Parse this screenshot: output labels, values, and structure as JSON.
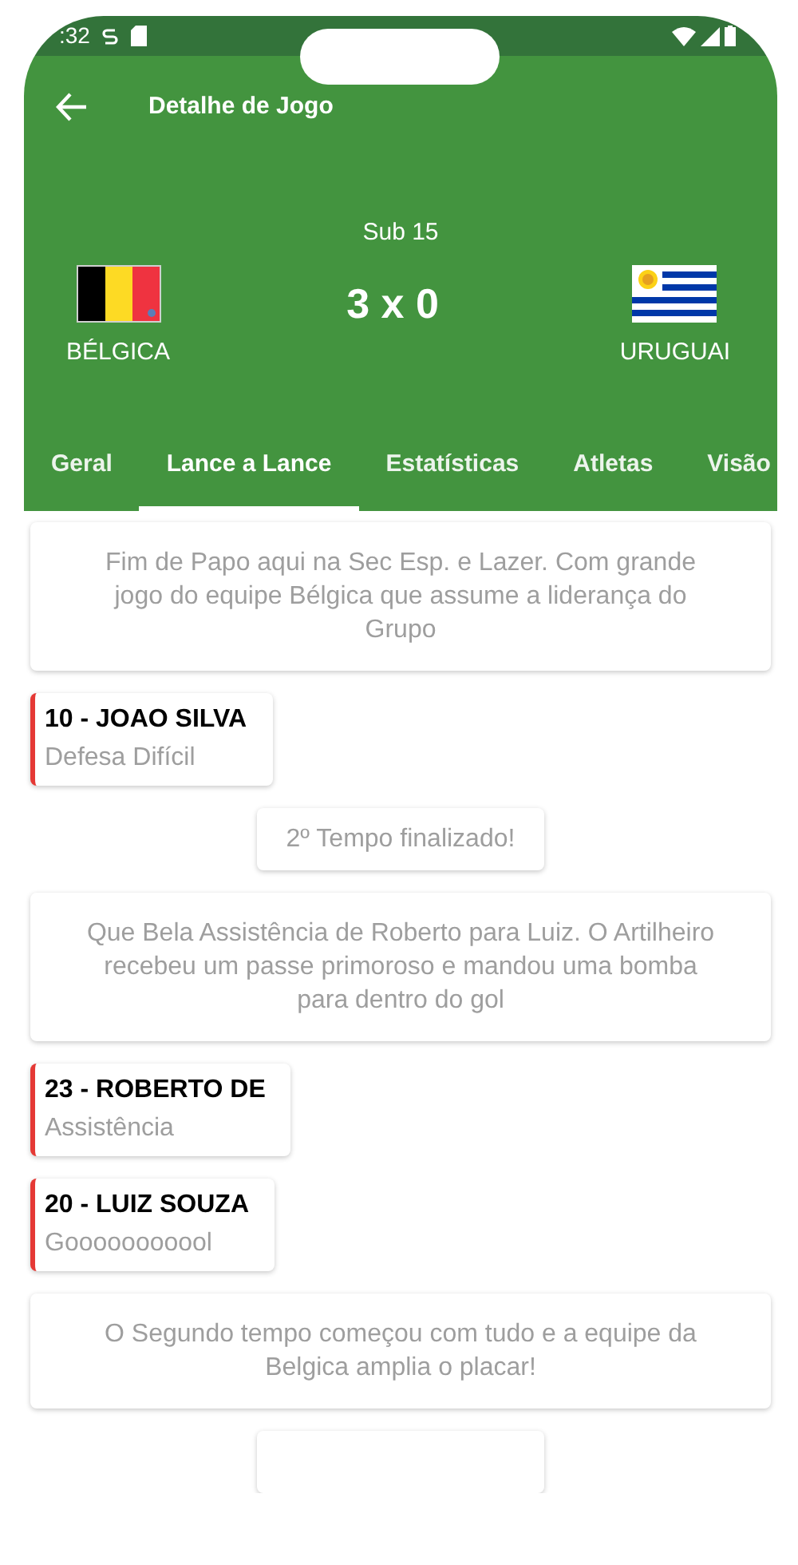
{
  "status_bar": {
    "time": ":32"
  },
  "toolbar": {
    "title": "Detalhe de Jogo"
  },
  "match": {
    "category": "Sub 15",
    "score": "3 x 0",
    "home": {
      "name": "BÉLGICA",
      "kind": "belgium"
    },
    "away": {
      "name": "URUGUAI",
      "kind": "uruguay"
    }
  },
  "tabs": [
    {
      "label": "Geral",
      "selected": false
    },
    {
      "label": "Lance a Lance",
      "selected": true
    },
    {
      "label": "Estatísticas",
      "selected": false
    },
    {
      "label": "Atletas",
      "selected": false
    },
    {
      "label": "Visão",
      "selected": false
    }
  ],
  "events": [
    {
      "kind": "narration",
      "text": "Fim de Papo aqui na Sec Esp. e Lazer. Com grande jogo do equipe Bélgica que assume a liderança do Grupo"
    },
    {
      "kind": "player",
      "player": "10 - JOAO SILVA",
      "action": "Defesa Difícil",
      "color": "#e53935"
    },
    {
      "kind": "notice",
      "text": "2º Tempo finalizado!"
    },
    {
      "kind": "narration",
      "text": "Que Bela Assistência de Roberto para Luiz. O Artilheiro recebeu um passe primoroso e mandou uma bomba para dentro do gol"
    },
    {
      "kind": "player",
      "player": "23 - ROBERTO DE",
      "action": "Assistência",
      "color": "#e53935"
    },
    {
      "kind": "player",
      "player": "20 - LUIZ SOUZA",
      "action": "Gooooooooool",
      "color": "#e53935"
    },
    {
      "kind": "narration",
      "text": "O Segundo tempo começou com tudo e a equipe da Belgica amplia o placar!"
    },
    {
      "kind": "notice"
    }
  ]
}
